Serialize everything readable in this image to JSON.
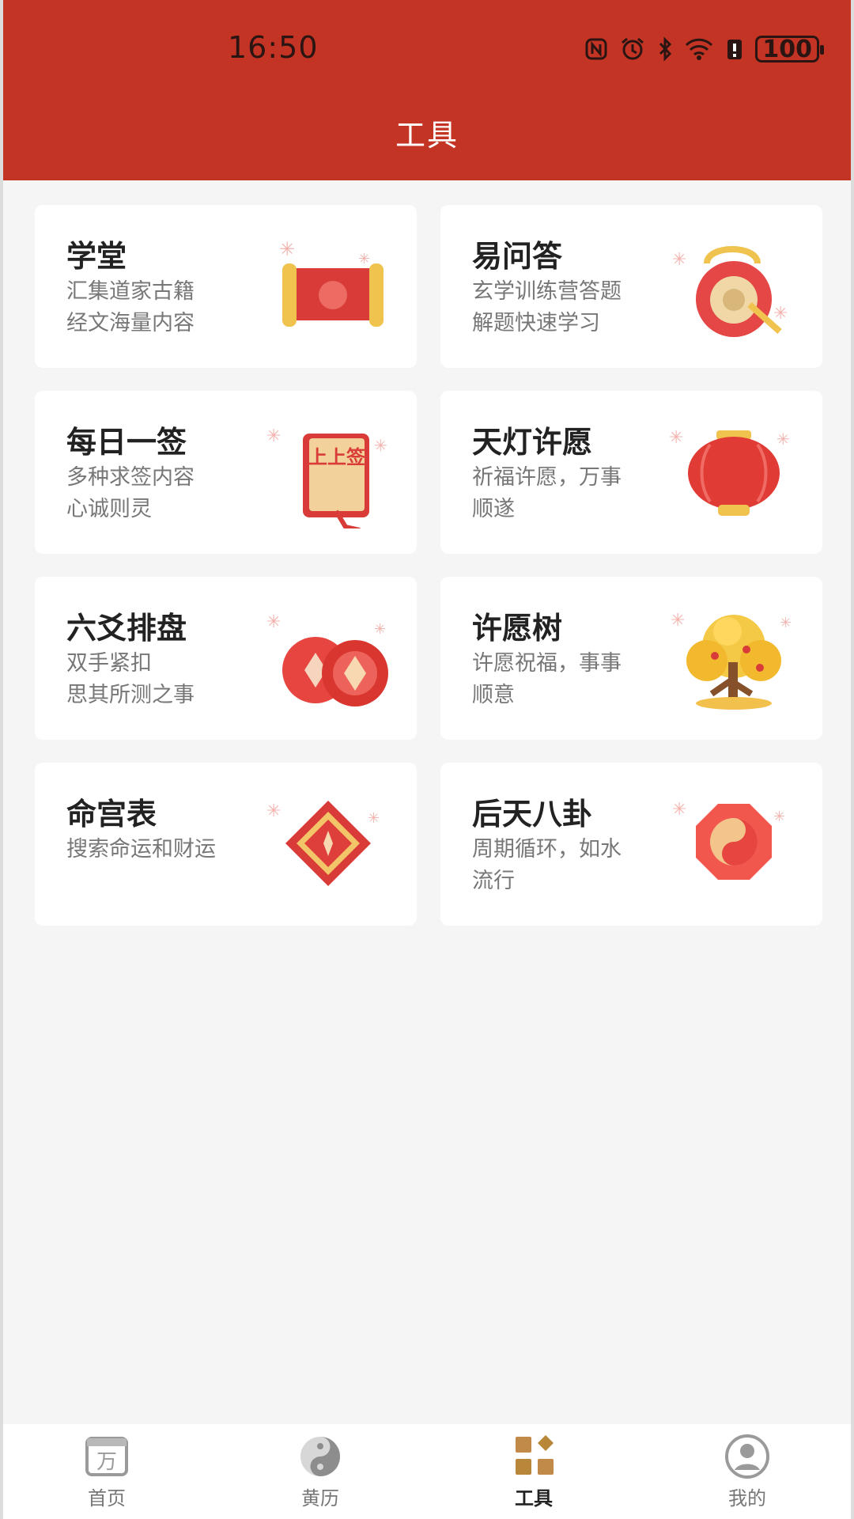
{
  "status_bar": {
    "time": "16:50",
    "battery": "100"
  },
  "header": {
    "title": "工具"
  },
  "colors": {
    "brand_red": "#c33425",
    "gold": "#b9873a",
    "background": "#f5f5f5"
  },
  "tools": [
    {
      "title": "学堂",
      "desc1": "汇集道家古籍",
      "desc2": "经文海量内容",
      "icon": "scroll-icon"
    },
    {
      "title": "易问答",
      "desc1": "玄学训练营答题",
      "desc2": "解题快速学习",
      "icon": "gong-icon"
    },
    {
      "title": "每日一签",
      "desc1": "多种求签内容",
      "desc2": "心诚则灵",
      "icon": "fortune-stick-icon",
      "art_text": "上上签"
    },
    {
      "title": "天灯许愿",
      "desc1": "祈福许愿，万事",
      "desc2": "顺遂",
      "icon": "lantern-icon"
    },
    {
      "title": "六爻排盘",
      "desc1": "双手紧扣",
      "desc2": "思其所测之事",
      "icon": "coins-icon"
    },
    {
      "title": "许愿树",
      "desc1": "许愿祝福，事事",
      "desc2": "顺意",
      "icon": "wishing-tree-icon"
    },
    {
      "title": "命宫表",
      "desc1": "搜索命运和财运",
      "desc2": "",
      "icon": "compass-icon"
    },
    {
      "title": "后天八卦",
      "desc1": "周期循环，如水",
      "desc2": "流行",
      "icon": "bagua-icon"
    }
  ],
  "tabbar": {
    "items": [
      {
        "label": "首页",
        "icon": "calendar-icon",
        "icon_char": "万"
      },
      {
        "label": "黄历",
        "icon": "yinyang-icon"
      },
      {
        "label": "工具",
        "icon": "tools-grid-icon",
        "active": true
      },
      {
        "label": "我的",
        "icon": "profile-icon"
      }
    ]
  }
}
